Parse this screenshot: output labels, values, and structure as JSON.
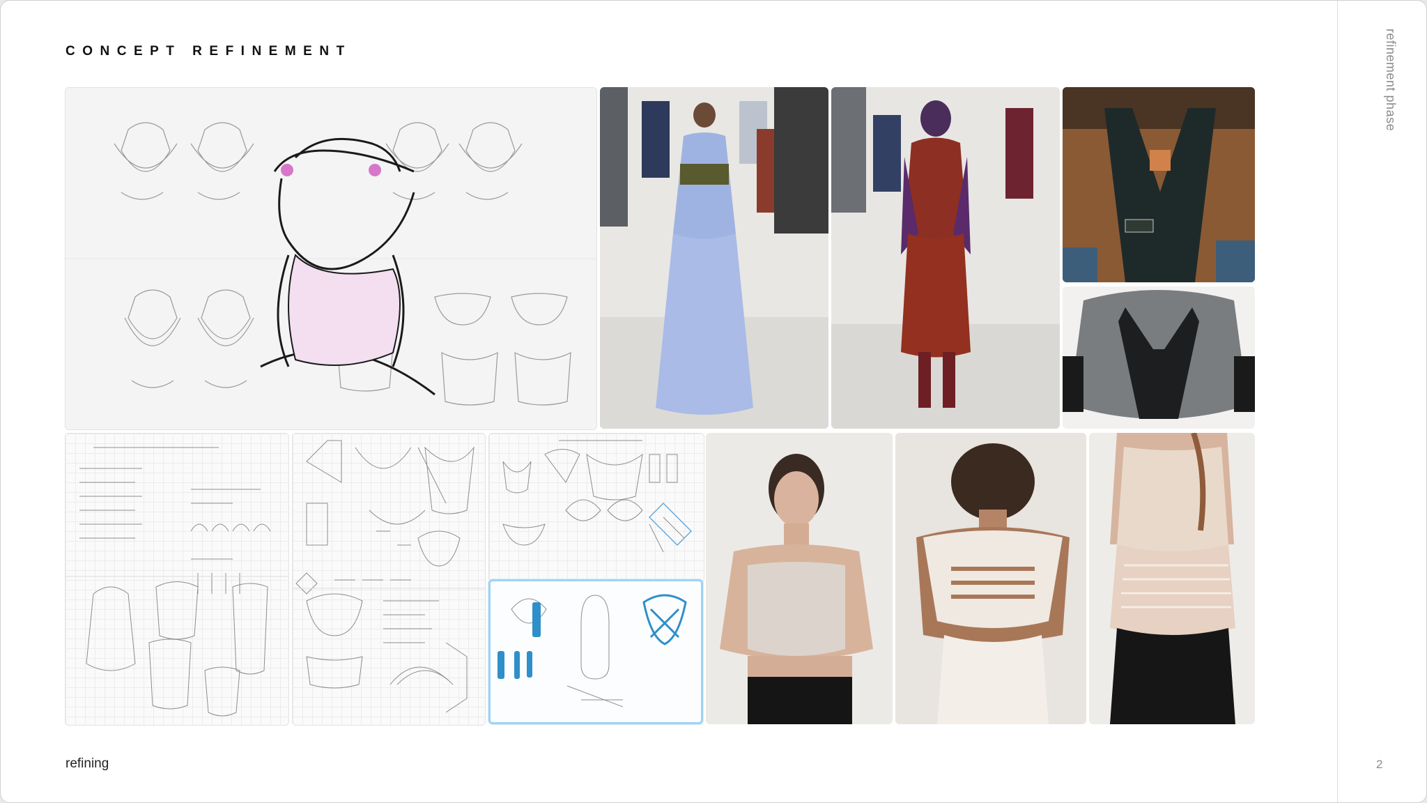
{
  "header": {
    "title": "CONCEPT REFINEMENT"
  },
  "sidebar": {
    "label": "refinement phase"
  },
  "footer": {
    "section_label": "refining",
    "page_number": "2"
  },
  "colors": {
    "accent_blue": "#9fd3f3",
    "ink": "#111111",
    "muted": "#8a8a8a"
  }
}
